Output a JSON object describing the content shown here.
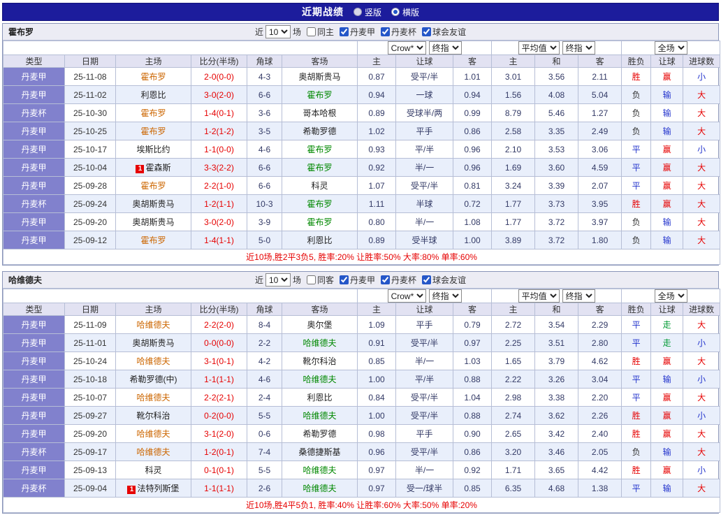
{
  "topbar": {
    "title": "近期战绩",
    "vertical": "竖版",
    "horizontal": "横版",
    "selected": "横版"
  },
  "filters": {
    "near_label": "近",
    "matches_label": "场",
    "leagues": [
      {
        "label": "丹麦甲",
        "checked": true
      },
      {
        "label": "丹麦杯",
        "checked": true
      },
      {
        "label": "球会友谊",
        "checked": true
      }
    ]
  },
  "columns": {
    "main": [
      "类型",
      "日期",
      "主场",
      "比分(半场)",
      "角球",
      "客场"
    ],
    "sub": [
      "主",
      "让球",
      "客",
      "主",
      "和",
      "客",
      "胜负",
      "让球",
      "进球数"
    ]
  },
  "colors": {
    "topbar_bg": "#1c1c9c",
    "type_cell_bg": "#8181cd",
    "score": "#e60000",
    "home_self": "#cc6600",
    "away_self": "#008800",
    "summary": "#e60000",
    "mark": {
      "胜": "#e60000",
      "平": "#2233cc",
      "负": "#333333",
      "赢": "#e60000",
      "输": "#2233cc",
      "走": "#009933",
      "大": "#e60000",
      "小": "#2233cc"
    }
  },
  "sections": [
    {
      "team": "霍布罗",
      "filter": {
        "count": "10",
        "same_label": "同主",
        "same_checked": false
      },
      "dropdowns": {
        "asia_company": "Crow*",
        "asia_stage": "终指",
        "euro_company": "平均值",
        "euro_stage": "终指",
        "scope": "全场"
      },
      "rows": [
        {
          "type": "丹麦甲",
          "date": "25-11-08",
          "home": "霍布罗",
          "home_self": true,
          "badge": "",
          "score": "2-0(0-0)",
          "corner": "4-3",
          "away": "奥胡斯贵马",
          "away_self": false,
          "asia_home": "0.87",
          "handicap": "受平/半",
          "asia_away": "1.01",
          "euro_home": "3.01",
          "euro_draw": "3.56",
          "euro_away": "2.11",
          "result": "胜",
          "handicap_result": "赢",
          "goals": "小"
        },
        {
          "type": "丹麦甲",
          "date": "25-11-02",
          "home": "利恩比",
          "home_self": false,
          "badge": "",
          "score": "3-0(2-0)",
          "corner": "6-6",
          "away": "霍布罗",
          "away_self": true,
          "asia_home": "0.94",
          "handicap": "一球",
          "asia_away": "0.94",
          "euro_home": "1.56",
          "euro_draw": "4.08",
          "euro_away": "5.04",
          "result": "负",
          "handicap_result": "输",
          "goals": "大"
        },
        {
          "type": "丹麦杯",
          "date": "25-10-30",
          "home": "霍布罗",
          "home_self": true,
          "badge": "",
          "score": "1-4(0-1)",
          "corner": "3-6",
          "away": "哥本哈根",
          "away_self": false,
          "asia_home": "0.89",
          "handicap": "受球半/两",
          "asia_away": "0.99",
          "euro_home": "8.79",
          "euro_draw": "5.46",
          "euro_away": "1.27",
          "result": "负",
          "handicap_result": "输",
          "goals": "大"
        },
        {
          "type": "丹麦甲",
          "date": "25-10-25",
          "home": "霍布罗",
          "home_self": true,
          "badge": "",
          "score": "1-2(1-2)",
          "corner": "3-5",
          "away": "希勒罗德",
          "away_self": false,
          "asia_home": "1.02",
          "handicap": "平手",
          "asia_away": "0.86",
          "euro_home": "2.58",
          "euro_draw": "3.35",
          "euro_away": "2.49",
          "result": "负",
          "handicap_result": "输",
          "goals": "大"
        },
        {
          "type": "丹麦甲",
          "date": "25-10-17",
          "home": "埃斯比约",
          "home_self": false,
          "badge": "",
          "score": "1-1(0-0)",
          "corner": "4-6",
          "away": "霍布罗",
          "away_self": true,
          "asia_home": "0.93",
          "handicap": "平/半",
          "asia_away": "0.96",
          "euro_home": "2.10",
          "euro_draw": "3.53",
          "euro_away": "3.06",
          "result": "平",
          "handicap_result": "赢",
          "goals": "小"
        },
        {
          "type": "丹麦甲",
          "date": "25-10-04",
          "home": "霍森斯",
          "home_self": false,
          "badge": "1",
          "score": "3-3(2-2)",
          "corner": "6-6",
          "away": "霍布罗",
          "away_self": true,
          "asia_home": "0.92",
          "handicap": "半/一",
          "asia_away": "0.96",
          "euro_home": "1.69",
          "euro_draw": "3.60",
          "euro_away": "4.59",
          "result": "平",
          "handicap_result": "赢",
          "goals": "大"
        },
        {
          "type": "丹麦甲",
          "date": "25-09-28",
          "home": "霍布罗",
          "home_self": true,
          "badge": "",
          "score": "2-2(1-0)",
          "corner": "6-6",
          "away": "科灵",
          "away_self": false,
          "asia_home": "1.07",
          "handicap": "受平/半",
          "asia_away": "0.81",
          "euro_home": "3.24",
          "euro_draw": "3.39",
          "euro_away": "2.07",
          "result": "平",
          "handicap_result": "赢",
          "goals": "大"
        },
        {
          "type": "丹麦杯",
          "date": "25-09-24",
          "home": "奥胡斯贵马",
          "home_self": false,
          "badge": "",
          "score": "1-2(1-1)",
          "corner": "10-3",
          "away": "霍布罗",
          "away_self": true,
          "asia_home": "1.11",
          "handicap": "半球",
          "asia_away": "0.72",
          "euro_home": "1.77",
          "euro_draw": "3.73",
          "euro_away": "3.95",
          "result": "胜",
          "handicap_result": "赢",
          "goals": "大"
        },
        {
          "type": "丹麦甲",
          "date": "25-09-20",
          "home": "奥胡斯贵马",
          "home_self": false,
          "badge": "",
          "score": "3-0(2-0)",
          "corner": "3-9",
          "away": "霍布罗",
          "away_self": true,
          "asia_home": "0.80",
          "handicap": "半/一",
          "asia_away": "1.08",
          "euro_home": "1.77",
          "euro_draw": "3.72",
          "euro_away": "3.97",
          "result": "负",
          "handicap_result": "输",
          "goals": "大"
        },
        {
          "type": "丹麦甲",
          "date": "25-09-12",
          "home": "霍布罗",
          "home_self": true,
          "badge": "",
          "score": "1-4(1-1)",
          "corner": "5-0",
          "away": "利恩比",
          "away_self": false,
          "asia_home": "0.89",
          "handicap": "受半球",
          "asia_away": "1.00",
          "euro_home": "3.89",
          "euro_draw": "3.72",
          "euro_away": "1.80",
          "result": "负",
          "handicap_result": "输",
          "goals": "大"
        }
      ],
      "summary": "近10场,胜2平3负5, 胜率:20% 让胜率:50% 大率:80% 单率:60%"
    },
    {
      "team": "哈维德夫",
      "filter": {
        "count": "10",
        "same_label": "同客",
        "same_checked": false
      },
      "dropdowns": {
        "asia_company": "Crow*",
        "asia_stage": "终指",
        "euro_company": "平均值",
        "euro_stage": "终指",
        "scope": "全场"
      },
      "rows": [
        {
          "type": "丹麦甲",
          "date": "25-11-09",
          "home": "哈维德夫",
          "home_self": true,
          "badge": "",
          "score": "2-2(2-0)",
          "corner": "8-4",
          "away": "奥尔堡",
          "away_self": false,
          "asia_home": "1.09",
          "handicap": "平手",
          "asia_away": "0.79",
          "euro_home": "2.72",
          "euro_draw": "3.54",
          "euro_away": "2.29",
          "result": "平",
          "handicap_result": "走",
          "goals": "大"
        },
        {
          "type": "丹麦甲",
          "date": "25-11-01",
          "home": "奥胡斯贵马",
          "home_self": false,
          "badge": "",
          "score": "0-0(0-0)",
          "corner": "2-2",
          "away": "哈维德夫",
          "away_self": true,
          "asia_home": "0.91",
          "handicap": "受平/半",
          "asia_away": "0.97",
          "euro_home": "2.25",
          "euro_draw": "3.51",
          "euro_away": "2.80",
          "result": "平",
          "handicap_result": "走",
          "goals": "小"
        },
        {
          "type": "丹麦甲",
          "date": "25-10-24",
          "home": "哈维德夫",
          "home_self": true,
          "badge": "",
          "score": "3-1(0-1)",
          "corner": "4-2",
          "away": "靴尔科治",
          "away_self": false,
          "asia_home": "0.85",
          "handicap": "半/一",
          "asia_away": "1.03",
          "euro_home": "1.65",
          "euro_draw": "3.79",
          "euro_away": "4.62",
          "result": "胜",
          "handicap_result": "赢",
          "goals": "大"
        },
        {
          "type": "丹麦甲",
          "date": "25-10-18",
          "home": "希勒罗德(中)",
          "home_self": false,
          "badge": "",
          "score": "1-1(1-1)",
          "corner": "4-6",
          "away": "哈维德夫",
          "away_self": true,
          "asia_home": "1.00",
          "handicap": "平/半",
          "asia_away": "0.88",
          "euro_home": "2.22",
          "euro_draw": "3.26",
          "euro_away": "3.04",
          "result": "平",
          "handicap_result": "输",
          "goals": "小"
        },
        {
          "type": "丹麦甲",
          "date": "25-10-07",
          "home": "哈维德夫",
          "home_self": true,
          "badge": "",
          "score": "2-2(2-1)",
          "corner": "2-4",
          "away": "利恩比",
          "away_self": false,
          "asia_home": "0.84",
          "handicap": "受平/半",
          "asia_away": "1.04",
          "euro_home": "2.98",
          "euro_draw": "3.38",
          "euro_away": "2.20",
          "result": "平",
          "handicap_result": "赢",
          "goals": "大"
        },
        {
          "type": "丹麦甲",
          "date": "25-09-27",
          "home": "靴尔科治",
          "home_self": false,
          "badge": "",
          "score": "0-2(0-0)",
          "corner": "5-5",
          "away": "哈维德夫",
          "away_self": true,
          "asia_home": "1.00",
          "handicap": "受平/半",
          "asia_away": "0.88",
          "euro_home": "2.74",
          "euro_draw": "3.62",
          "euro_away": "2.26",
          "result": "胜",
          "handicap_result": "赢",
          "goals": "小"
        },
        {
          "type": "丹麦甲",
          "date": "25-09-20",
          "home": "哈维德夫",
          "home_self": true,
          "badge": "",
          "score": "3-1(2-0)",
          "corner": "0-6",
          "away": "希勒罗德",
          "away_self": false,
          "asia_home": "0.98",
          "handicap": "平手",
          "asia_away": "0.90",
          "euro_home": "2.65",
          "euro_draw": "3.42",
          "euro_away": "2.40",
          "result": "胜",
          "handicap_result": "赢",
          "goals": "大"
        },
        {
          "type": "丹麦杯",
          "date": "25-09-17",
          "home": "哈维德夫",
          "home_self": true,
          "badge": "",
          "score": "1-2(0-1)",
          "corner": "7-4",
          "away": "桑德捷斯基",
          "away_self": false,
          "asia_home": "0.96",
          "handicap": "受平/半",
          "asia_away": "0.86",
          "euro_home": "3.20",
          "euro_draw": "3.46",
          "euro_away": "2.05",
          "result": "负",
          "handicap_result": "输",
          "goals": "大"
        },
        {
          "type": "丹麦甲",
          "date": "25-09-13",
          "home": "科灵",
          "home_self": false,
          "badge": "",
          "score": "0-1(0-1)",
          "corner": "5-5",
          "away": "哈维德夫",
          "away_self": true,
          "asia_home": "0.97",
          "handicap": "半/一",
          "asia_away": "0.92",
          "euro_home": "1.71",
          "euro_draw": "3.65",
          "euro_away": "4.42",
          "result": "胜",
          "handicap_result": "赢",
          "goals": "小"
        },
        {
          "type": "丹麦杯",
          "date": "25-09-04",
          "home": "法特列斯堡",
          "home_self": false,
          "badge": "1",
          "score": "1-1(1-1)",
          "corner": "2-6",
          "away": "哈维德夫",
          "away_self": true,
          "asia_home": "0.97",
          "handicap": "受一/球半",
          "asia_away": "0.85",
          "euro_home": "6.35",
          "euro_draw": "4.68",
          "euro_away": "1.38",
          "result": "平",
          "handicap_result": "输",
          "goals": "大"
        }
      ],
      "summary": "近10场,胜4平5负1, 胜率:40% 让胜率:60% 大率:50% 单率:20%"
    }
  ]
}
